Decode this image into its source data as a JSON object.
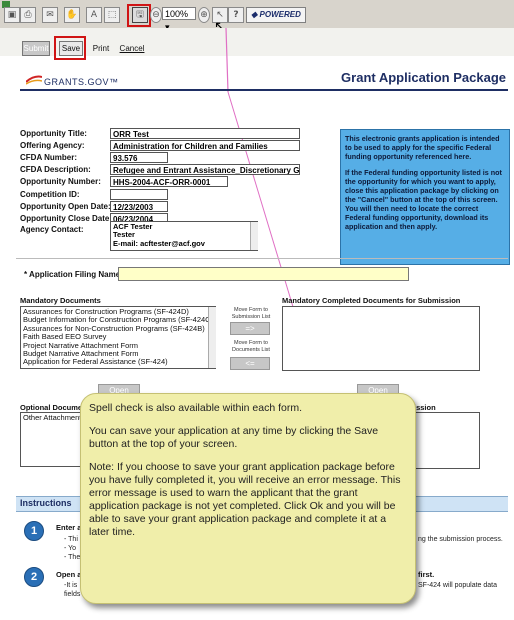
{
  "toolbar": {
    "zoom": "100%",
    "powered_label": "POWERED"
  },
  "form_buttons": {
    "submit": "Submit",
    "save": "Save",
    "print": "Print",
    "cancel": "Cancel"
  },
  "header": {
    "logo_text": "GRANTS.GOV™",
    "title": "Grant Application Package"
  },
  "fields": [
    {
      "label": "Opportunity Title:",
      "value": "ORR Test"
    },
    {
      "label": "Offering Agency:",
      "value": "Administration for Children and Families"
    },
    {
      "label": "CFDA Number:",
      "value": "93.576"
    },
    {
      "label": "CFDA Description:",
      "value": "Refugee and Entrant Assistance_Discretionary Grants"
    },
    {
      "label": "Opportunity Number:",
      "value": "HHS-2004-ACF-ORR-0001"
    },
    {
      "label": "Competition ID:",
      "value": ""
    },
    {
      "label": "Opportunity Open Date:",
      "value": "12/23/2003"
    },
    {
      "label": "Opportunity Close Date:",
      "value": "06/23/2004"
    }
  ],
  "agency_contact": {
    "label": "Agency Contact:",
    "lines": [
      "ACF Tester",
      "Tester",
      "E-mail: acftester@acf.gov"
    ]
  },
  "info_box": {
    "p1": "This electronic grants application is intended to be used to apply for the specific Federal funding opportunity referenced here.",
    "p2": "If the Federal funding opportunity listed is not the opportunity for which you want to apply, close this application package by clicking on the \"Cancel\" button at the top of this screen. You will then need to locate the correct Federal funding opportunity, download its application and then apply."
  },
  "filing_name": {
    "label": "* Application Filing Name:",
    "value": ""
  },
  "mandatory": {
    "title": "Mandatory Documents",
    "items": [
      "Assurances for Construction Programs (SF-424D)",
      "Budget Information for Construction Programs (SF-424C)",
      "Assurances for Non-Construction Programs (SF-424B)",
      "Faith Based EEO Survey",
      "Project Narrative Attachment Form",
      "Budget Narrative Attachment Form",
      "Application for Federal Assistance (SF-424)"
    ],
    "move_to_label": "Move Form to Submission List",
    "move_to_button": "=>",
    "move_back_label": "Move Form to Documents List",
    "move_back_button": "<=",
    "completed_title": "Mandatory Completed Documents for Submission",
    "open_form": "Open Form"
  },
  "optional": {
    "title": "Optional Documents",
    "items": [
      "Other Attachments"
    ],
    "completed_suffix": "ission"
  },
  "instructions": {
    "title": "Instructions",
    "step1": "Enter a",
    "step1_lines": [
      "- Thi",
      "- Yo",
      "- The"
    ],
    "step1_right": "ng the submission process.",
    "step2": "Open ar",
    "step2_lines": [
      "-It is",
      "fields"
    ],
    "step2_right_a": "first.",
    "step2_right_b": "SF-424 will populate data"
  },
  "tooltip": {
    "p1": "Spell check is also available within each form.",
    "p2": "You can save your application at any time by clicking the Save  button at the top of your screen.",
    "p3": "Note: If you choose to save your grant application package before you have fully completed it, you will receive an error message. This error message is used to warn the applicant that the grant application package is not yet completed.  Click Ok and you will be able to save your grant application package and complete it at a later time."
  },
  "colors": {
    "accent_red": "#d01414",
    "info_blue": "#56aee6",
    "tooltip_bg": "#f0eeaa",
    "header_navy": "#1e2e63"
  }
}
